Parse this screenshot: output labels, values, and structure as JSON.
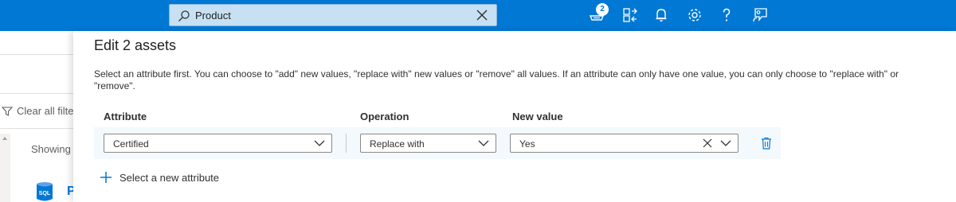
{
  "topbar": {
    "search_value": "Product",
    "notification_badge": "2",
    "icons": [
      "search-icon",
      "close-icon",
      "notification-tray-icon",
      "directory-switch-icon",
      "bell-icon",
      "gear-icon",
      "help-icon",
      "feedback-icon"
    ],
    "colors": {
      "bar": "#0078d4",
      "search_bg": "#c7e0f4"
    }
  },
  "background": {
    "clear_filters_label": "Clear all filte",
    "showing_label": "Showing '",
    "asset_icon_label": "SQL",
    "asset_name_partial": "P"
  },
  "panel": {
    "title": "Edit 2 assets",
    "description": "Select an attribute first. You can choose to \"add\" new values, \"replace with\" new values or \"remove\" all values. If an attribute can only have one value, you can only choose to \"replace with\" or \"remove\".",
    "columns": {
      "attribute": "Attribute",
      "operation": "Operation",
      "new_value": "New value"
    },
    "row": {
      "attribute_value": "Certified",
      "operation_value": "Replace with",
      "new_value": "Yes"
    },
    "add_attribute_label": "Select a new attribute",
    "colors": {
      "row_bg": "#f3f9fd",
      "accent": "#0078d4"
    }
  }
}
